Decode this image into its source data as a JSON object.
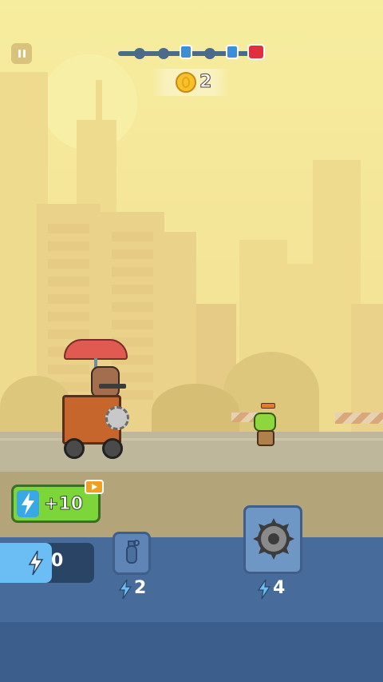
{
  "hud": {
    "pause_icon": "pause-icon",
    "wave_progress": {
      "nodes": [
        "dot",
        "dot",
        "shield",
        "dot",
        "shield",
        "boss"
      ],
      "colors": {
        "track": "#4a6b8a",
        "shield": "#3c8fd4",
        "boss": "#e03040"
      }
    },
    "coins": "2"
  },
  "bonus": {
    "label": "+10",
    "icon": "energy-bolt-icon",
    "ad_icon": "video-ad-icon"
  },
  "energy": {
    "value": "0",
    "fill_fraction": 0.55
  },
  "units": [
    {
      "name": "grenade",
      "icon": "grenade-icon",
      "cost": "2"
    },
    {
      "name": "saw-blade",
      "icon": "saw-blade-icon",
      "cost": "4"
    }
  ],
  "colors": {
    "accent_green": "#7cd63a",
    "energy_blue": "#6bbef3",
    "panel_blue": "#476c9c"
  }
}
